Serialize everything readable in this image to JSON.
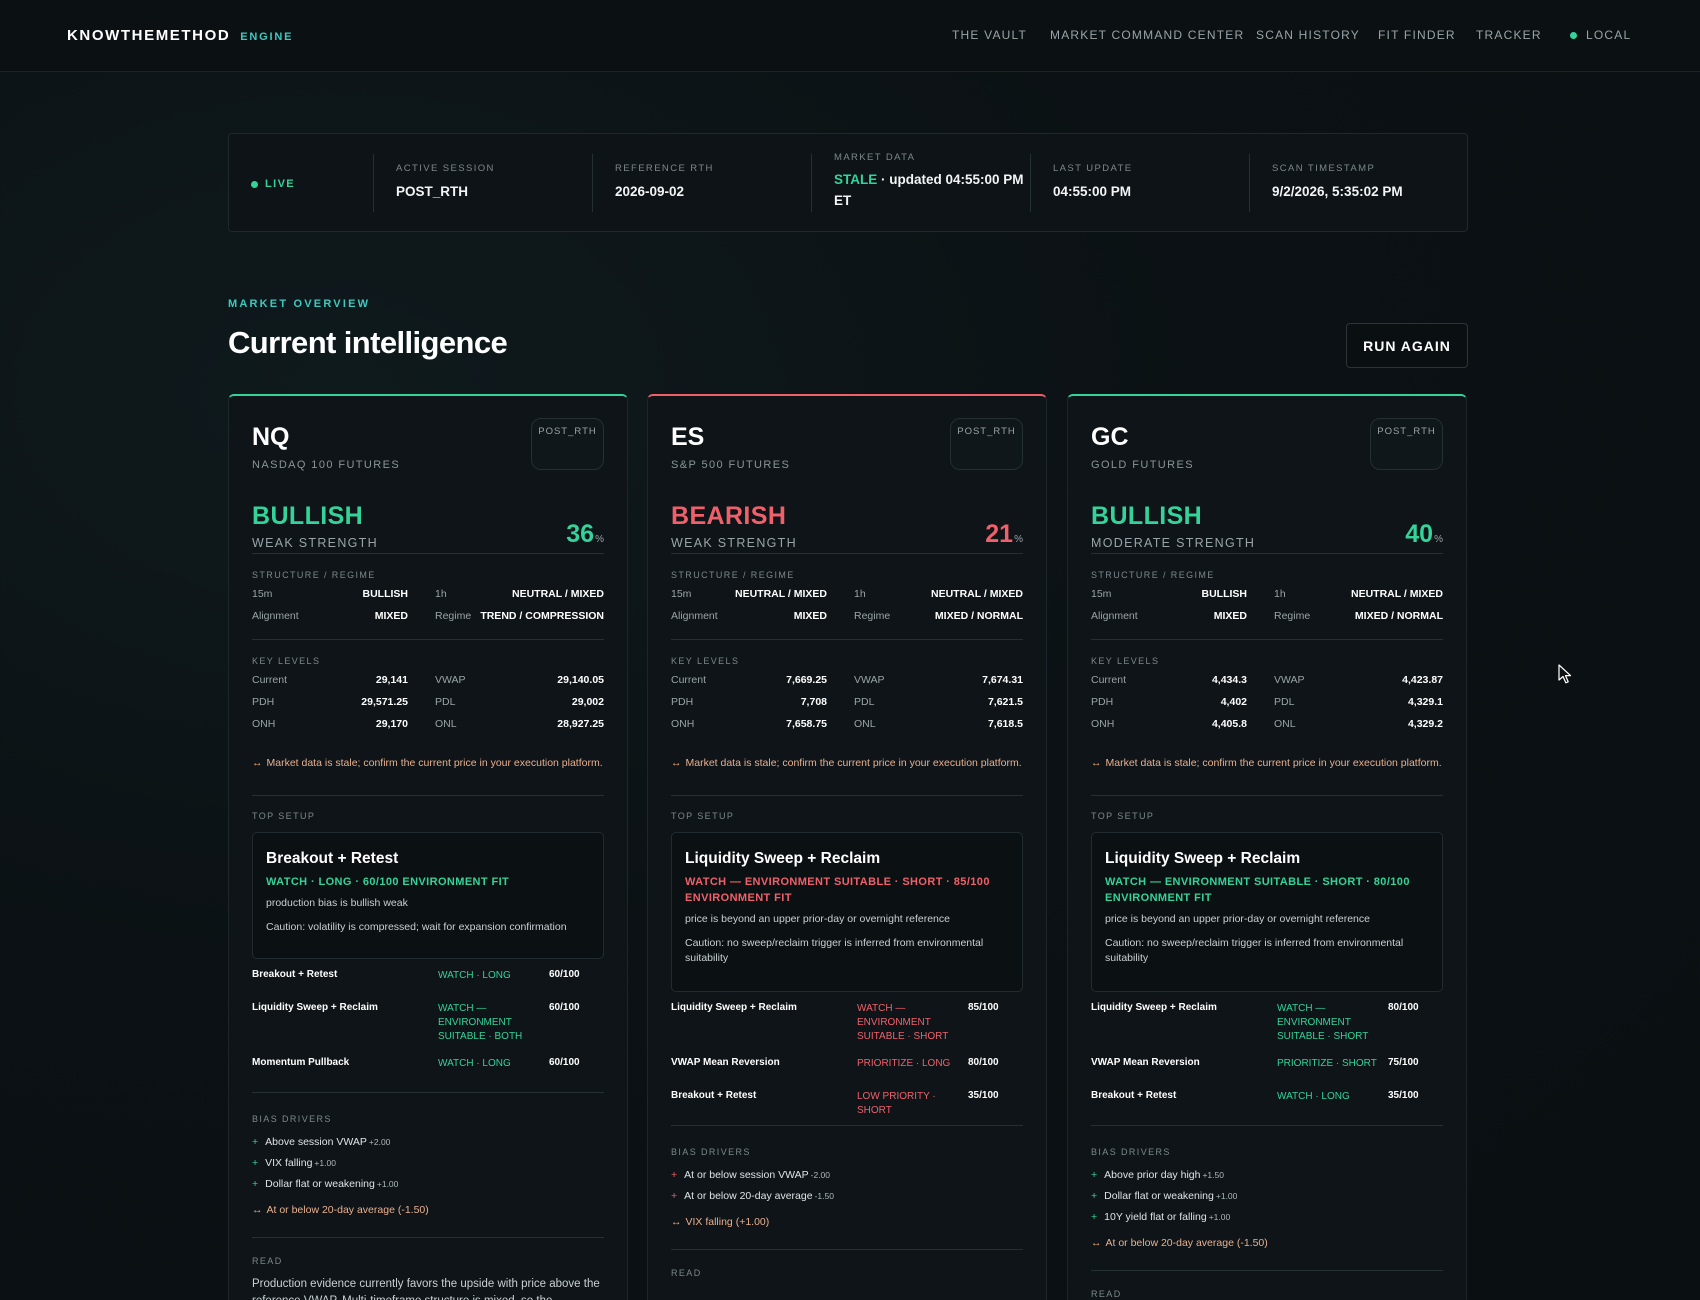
{
  "nav": {
    "brand": "KNOWTHEMETHOD",
    "brand_tag": "ENGINE",
    "links": [
      "THE VAULT",
      "MARKET COMMAND CENTER",
      "SCAN HISTORY",
      "FIT FINDER",
      "TRACKER"
    ],
    "local": "LOCAL"
  },
  "status": {
    "live": "LIVE",
    "active_session_label": "ACTIVE SESSION",
    "active_session": "POST_RTH",
    "reference_label": "REFERENCE RTH",
    "reference": "2026-09-02",
    "market_label": "MARKET DATA",
    "market_stale": "STALE",
    "market_rest": " · updated 04:55:00 PM ET",
    "last_update_label": "LAST UPDATE",
    "last_update": "04:55:00 PM",
    "scan_label": "SCAN TIMESTAMP",
    "scan": "9/2/2026, 5:35:02 PM"
  },
  "overview": {
    "eyebrow": "MARKET OVERVIEW",
    "title": "Current intelligence",
    "run_again": "RUN AGAIN"
  },
  "labels": {
    "structure": "STRUCTURE / REGIME",
    "key_levels": "KEY LEVELS",
    "top_setup": "TOP SETUP",
    "bias_drivers": "BIAS DRIVERS",
    "read": "READ",
    "k_15m": "15m",
    "k_1h": "1h",
    "k_alignment": "Alignment",
    "k_regime": "Regime",
    "k_current": "Current",
    "k_vwap": "VWAP",
    "k_pdh": "PDH",
    "k_pdl": "PDL",
    "k_onh": "ONH",
    "k_onl": "ONL",
    "pct_sign": "%",
    "stale_warning": "Market data is stale; confirm the current price in your execution platform."
  },
  "colors": {
    "bull": "#34d399",
    "bear": "#f0606a",
    "accent": "#3ec9c0",
    "warn": "#e9b08e"
  },
  "cards": [
    {
      "symbol": "NQ",
      "name": "NASDAQ 100 FUTURES",
      "session": "POST_RTH",
      "bias": "BULLISH",
      "strength": "WEAK STRENGTH",
      "pct": "36",
      "s15m": "BULLISH",
      "s1h": "NEUTRAL / MIXED",
      "alignment": "MIXED",
      "regime": "TREND / COMPRESSION",
      "current": "29,141",
      "vwap": "29,140.05",
      "pdh": "29,571.25",
      "pdl": "29,002",
      "onh": "29,170",
      "onl": "28,927.25",
      "setup_title": "Breakout + Retest",
      "setup_sub": "WATCH · LONG · 60/100 ENVIRONMENT FIT",
      "setup_p1": "production bias is bullish weak",
      "setup_p2": "Caution: volatility is compressed; wait for expansion confirmation",
      "alts": [
        {
          "name": "Breakout + Retest",
          "status": "WATCH · LONG",
          "score": "60/100"
        },
        {
          "name": "Liquidity Sweep + Reclaim",
          "status": "WATCH — ENVIRONMENT SUITABLE · BOTH",
          "score": "60/100"
        },
        {
          "name": "Momentum Pullback",
          "status": "WATCH · LONG",
          "score": "60/100"
        }
      ],
      "drivers": [
        {
          "text": "Above session VWAP",
          "delta": "+2.00"
        },
        {
          "text": "VIX falling",
          "delta": "+1.00"
        },
        {
          "text": "Dollar flat or weakening",
          "delta": "+1.00"
        }
      ],
      "driver_warn": "At or below 20-day average (-1.50)",
      "read": "Production evidence currently favors the upside with price above the reference VWAP. Multi-timeframe structure is mixed, so the"
    },
    {
      "symbol": "ES",
      "name": "S&P 500 FUTURES",
      "session": "POST_RTH",
      "bias": "BEARISH",
      "strength": "WEAK STRENGTH",
      "pct": "21",
      "s15m": "NEUTRAL / MIXED",
      "s1h": "NEUTRAL / MIXED",
      "alignment": "MIXED",
      "regime": "MIXED / NORMAL",
      "current": "7,669.25",
      "vwap": "7,674.31",
      "pdh": "7,708",
      "pdl": "7,621.5",
      "onh": "7,658.75",
      "onl": "7,618.5",
      "setup_title": "Liquidity Sweep + Reclaim",
      "setup_sub": "WATCH — ENVIRONMENT SUITABLE · SHORT · 85/100 ENVIRONMENT FIT",
      "setup_p1": "price is beyond an upper prior-day or overnight reference",
      "setup_p2": "Caution: no sweep/reclaim trigger is inferred from environmental suitability",
      "alts": [
        {
          "name": "Liquidity Sweep + Reclaim",
          "status": "WATCH — ENVIRONMENT SUITABLE · SHORT",
          "score": "85/100"
        },
        {
          "name": "VWAP Mean Reversion",
          "status": "PRIORITIZE · LONG",
          "score": "80/100"
        },
        {
          "name": "Breakout + Retest",
          "status": "LOW PRIORITY · SHORT",
          "score": "35/100"
        }
      ],
      "drivers": [
        {
          "text": "At or below session VWAP",
          "delta": "-2.00"
        },
        {
          "text": "At or below 20-day average",
          "delta": "-1.50"
        }
      ],
      "driver_warn": "VIX falling (+1.00)",
      "read": ""
    },
    {
      "symbol": "GC",
      "name": "GOLD FUTURES",
      "session": "POST_RTH",
      "bias": "BULLISH",
      "strength": "MODERATE STRENGTH",
      "pct": "40",
      "s15m": "BULLISH",
      "s1h": "NEUTRAL / MIXED",
      "alignment": "MIXED",
      "regime": "MIXED / NORMAL",
      "current": "4,434.3",
      "vwap": "4,423.87",
      "pdh": "4,402",
      "pdl": "4,329.1",
      "onh": "4,405.8",
      "onl": "4,329.2",
      "setup_title": "Liquidity Sweep + Reclaim",
      "setup_sub": "WATCH — ENVIRONMENT SUITABLE · SHORT · 80/100 ENVIRONMENT FIT",
      "setup_p1": "price is beyond an upper prior-day or overnight reference",
      "setup_p2": "Caution: no sweep/reclaim trigger is inferred from environmental suitability",
      "alts": [
        {
          "name": "Liquidity Sweep + Reclaim",
          "status": "WATCH — ENVIRONMENT SUITABLE · SHORT",
          "score": "80/100"
        },
        {
          "name": "VWAP Mean Reversion",
          "status": "PRIORITIZE · SHORT",
          "score": "75/100"
        },
        {
          "name": "Breakout + Retest",
          "status": "WATCH · LONG",
          "score": "35/100"
        }
      ],
      "drivers": [
        {
          "text": "Above prior day high",
          "delta": "+1.50"
        },
        {
          "text": "Dollar flat or weakening",
          "delta": "+1.00"
        },
        {
          "text": "10Y yield flat or falling",
          "delta": "+1.00"
        }
      ],
      "driver_warn": "At or below 20-day average (-1.50)",
      "read": ""
    }
  ]
}
